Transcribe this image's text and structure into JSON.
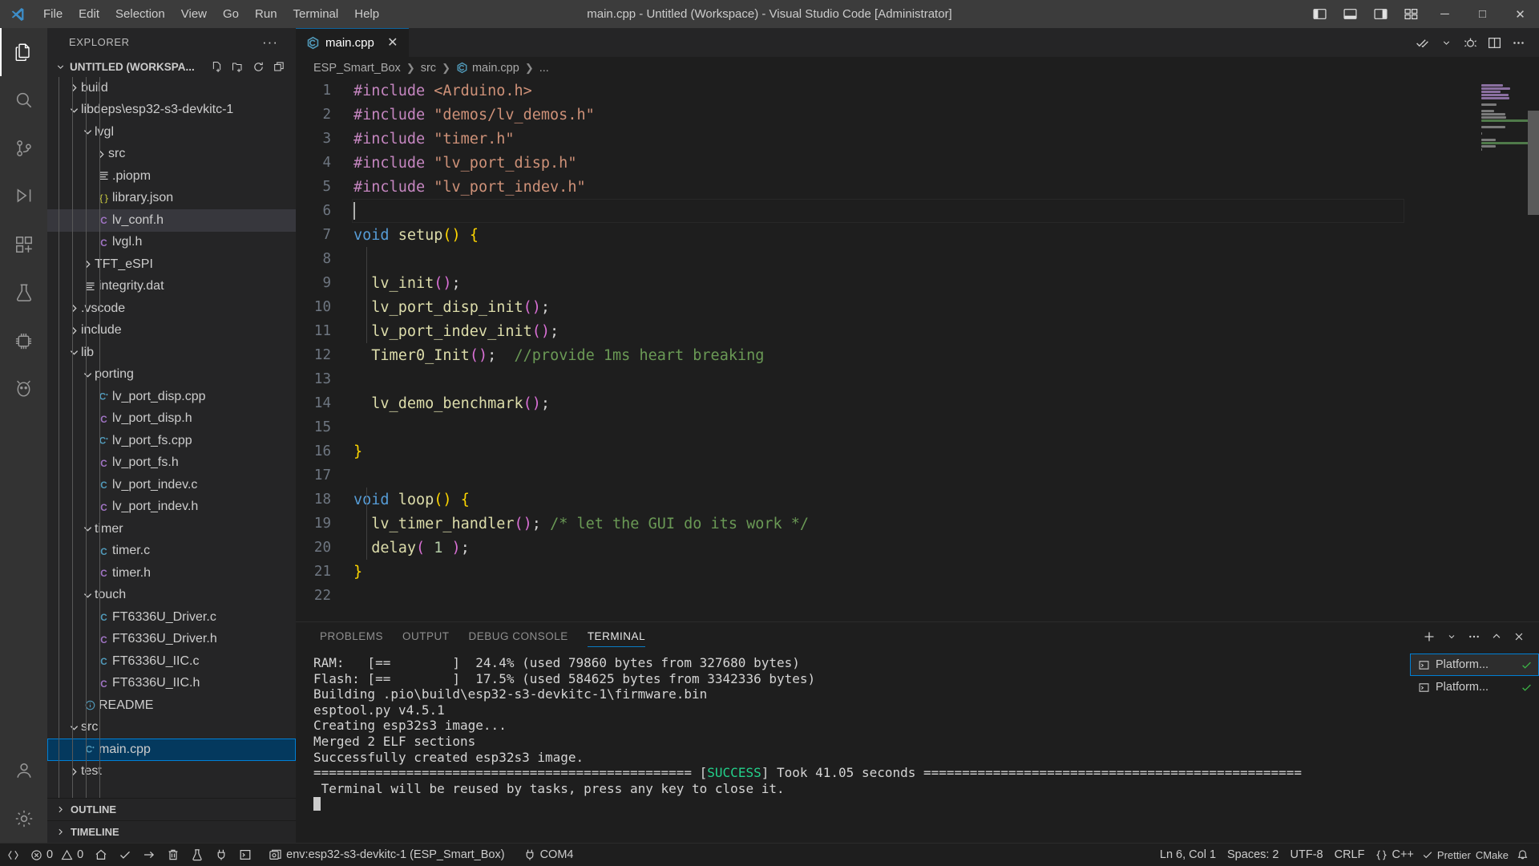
{
  "window": {
    "title": "main.cpp - Untitled (Workspace) - Visual Studio Code [Administrator]",
    "menu": [
      "File",
      "Edit",
      "Selection",
      "View",
      "Go",
      "Run",
      "Terminal",
      "Help"
    ],
    "controls": {
      "minimize": "─",
      "maximize": "□",
      "close": "✕"
    },
    "layout_icons": [
      "panel-left-icon",
      "panel-bottom-icon",
      "panel-right-icon",
      "customize-layout-icon"
    ]
  },
  "activitybar": {
    "items": [
      {
        "name": "explorer",
        "icon": "files-icon",
        "active": true
      },
      {
        "name": "search",
        "icon": "search-icon",
        "active": false
      },
      {
        "name": "source-control",
        "icon": "source-control-icon",
        "active": false
      },
      {
        "name": "run-and-debug",
        "icon": "debug-icon",
        "active": false
      },
      {
        "name": "extensions",
        "icon": "extensions-icon",
        "active": false
      },
      {
        "name": "testing",
        "icon": "beaker-icon",
        "active": false
      },
      {
        "name": "platformio",
        "icon": "platformio-icon",
        "active": false
      },
      {
        "name": "pio-home",
        "icon": "alien-icon",
        "active": false
      }
    ],
    "bottom": [
      {
        "name": "accounts",
        "icon": "account-icon"
      },
      {
        "name": "settings",
        "icon": "gear-icon"
      }
    ]
  },
  "sidebar": {
    "title": "EXPLORER",
    "more_label": "···",
    "workspace": {
      "label": "UNTITLED (WORKSPA...",
      "actions": [
        "new-file-icon",
        "new-folder-icon",
        "refresh-icon",
        "collapse-all-icon"
      ]
    },
    "tree": [
      {
        "label": "build",
        "depth": 2,
        "type": "folder",
        "state": "collapsed",
        "icon": "chevron-right-icon"
      },
      {
        "label": "libdeps\\esp32-s3-devkitc-1",
        "depth": 2,
        "type": "folder",
        "state": "expanded",
        "icon": "chevron-down-icon"
      },
      {
        "label": "lvgl",
        "depth": 3,
        "type": "folder",
        "state": "expanded",
        "icon": "chevron-down-icon"
      },
      {
        "label": "src",
        "depth": 4,
        "type": "folder",
        "state": "collapsed",
        "icon": "chevron-right-icon"
      },
      {
        "label": ".piopm",
        "depth": 4,
        "type": "file",
        "icon": "text-file-icon"
      },
      {
        "label": "library.json",
        "depth": 4,
        "type": "file",
        "icon": "json-icon"
      },
      {
        "label": "lv_conf.h",
        "depth": 4,
        "type": "file",
        "icon": "c-header-icon",
        "selected": "inactive"
      },
      {
        "label": "lvgl.h",
        "depth": 4,
        "type": "file",
        "icon": "c-header-icon"
      },
      {
        "label": "TFT_eSPI",
        "depth": 3,
        "type": "folder",
        "state": "collapsed",
        "icon": "chevron-right-icon"
      },
      {
        "label": "integrity.dat",
        "depth": 3,
        "type": "file",
        "icon": "text-file-icon"
      },
      {
        "label": ".vscode",
        "depth": 2,
        "type": "folder",
        "state": "collapsed",
        "icon": "chevron-right-icon"
      },
      {
        "label": "include",
        "depth": 2,
        "type": "folder",
        "state": "collapsed",
        "icon": "chevron-right-icon"
      },
      {
        "label": "lib",
        "depth": 2,
        "type": "folder",
        "state": "expanded",
        "icon": "chevron-down-icon"
      },
      {
        "label": "porting",
        "depth": 3,
        "type": "folder",
        "state": "expanded",
        "icon": "chevron-down-icon"
      },
      {
        "label": "lv_port_disp.cpp",
        "depth": 4,
        "type": "file",
        "icon": "cpp-icon"
      },
      {
        "label": "lv_port_disp.h",
        "depth": 4,
        "type": "file",
        "icon": "c-header-icon"
      },
      {
        "label": "lv_port_fs.cpp",
        "depth": 4,
        "type": "file",
        "icon": "cpp-icon"
      },
      {
        "label": "lv_port_fs.h",
        "depth": 4,
        "type": "file",
        "icon": "c-header-icon"
      },
      {
        "label": "lv_port_indev.c",
        "depth": 4,
        "type": "file",
        "icon": "c-source-icon"
      },
      {
        "label": "lv_port_indev.h",
        "depth": 4,
        "type": "file",
        "icon": "c-header-icon"
      },
      {
        "label": "timer",
        "depth": 3,
        "type": "folder",
        "state": "expanded",
        "icon": "chevron-down-icon"
      },
      {
        "label": "timer.c",
        "depth": 4,
        "type": "file",
        "icon": "c-source-icon"
      },
      {
        "label": "timer.h",
        "depth": 4,
        "type": "file",
        "icon": "c-header-icon"
      },
      {
        "label": "touch",
        "depth": 3,
        "type": "folder",
        "state": "expanded",
        "icon": "chevron-down-icon"
      },
      {
        "label": "FT6336U_Driver.c",
        "depth": 4,
        "type": "file",
        "icon": "c-source-icon"
      },
      {
        "label": "FT6336U_Driver.h",
        "depth": 4,
        "type": "file",
        "icon": "c-header-icon"
      },
      {
        "label": "FT6336U_IIC.c",
        "depth": 4,
        "type": "file",
        "icon": "c-source-icon"
      },
      {
        "label": "FT6336U_IIC.h",
        "depth": 4,
        "type": "file",
        "icon": "c-header-icon"
      },
      {
        "label": "README",
        "depth": 3,
        "type": "file",
        "icon": "info-icon"
      },
      {
        "label": "src",
        "depth": 2,
        "type": "folder",
        "state": "expanded",
        "icon": "chevron-down-icon"
      },
      {
        "label": "main.cpp",
        "depth": 3,
        "type": "file",
        "icon": "cpp-icon",
        "selected": "focus"
      },
      {
        "label": "test",
        "depth": 2,
        "type": "folder",
        "state": "collapsed",
        "icon": "chevron-right-icon"
      }
    ],
    "panels": [
      {
        "label": "OUTLINE",
        "icon": "chevron-right-icon"
      },
      {
        "label": "TIMELINE",
        "icon": "chevron-right-icon"
      }
    ]
  },
  "editor": {
    "tabs": [
      {
        "label": "main.cpp",
        "icon": "cpp-icon",
        "active": true,
        "close": "✕"
      }
    ],
    "tab_actions": [
      "check-all-icon",
      "chevron-down-icon",
      "debug-alt-icon",
      "split-editor-icon",
      "more-actions-icon"
    ],
    "breadcrumb": [
      "ESP_Smart_Box",
      "src",
      "main.cpp",
      "..."
    ],
    "breadcrumb_icon": "cpp-icon",
    "cursor_line": 6,
    "lines": [
      {
        "n": 1,
        "tokens": [
          {
            "t": "#include ",
            "c": "directive"
          },
          {
            "t": "<Arduino.h>",
            "c": "string"
          }
        ]
      },
      {
        "n": 2,
        "tokens": [
          {
            "t": "#include ",
            "c": "directive"
          },
          {
            "t": "\"demos/lv_demos.h\"",
            "c": "string"
          }
        ]
      },
      {
        "n": 3,
        "tokens": [
          {
            "t": "#include ",
            "c": "directive"
          },
          {
            "t": "\"timer.h\"",
            "c": "string"
          }
        ]
      },
      {
        "n": 4,
        "tokens": [
          {
            "t": "#include ",
            "c": "directive"
          },
          {
            "t": "\"lv_port_disp.h\"",
            "c": "string"
          }
        ]
      },
      {
        "n": 5,
        "tokens": [
          {
            "t": "#include ",
            "c": "directive"
          },
          {
            "t": "\"lv_port_indev.h\"",
            "c": "string"
          }
        ]
      },
      {
        "n": 6,
        "tokens": []
      },
      {
        "n": 7,
        "tokens": [
          {
            "t": "void",
            "c": "keyword"
          },
          {
            "t": " ",
            "c": "plain"
          },
          {
            "t": "setup",
            "c": "func"
          },
          {
            "t": "()",
            "c": "yellow"
          },
          {
            "t": " ",
            "c": "plain"
          },
          {
            "t": "{",
            "c": "yellow"
          }
        ]
      },
      {
        "n": 8,
        "tokens": []
      },
      {
        "n": 9,
        "tokens": [
          {
            "t": "  ",
            "c": "plain"
          },
          {
            "t": "lv_init",
            "c": "func"
          },
          {
            "t": "()",
            "c": "magenta"
          },
          {
            "t": ";",
            "c": "plain"
          }
        ]
      },
      {
        "n": 10,
        "tokens": [
          {
            "t": "  ",
            "c": "plain"
          },
          {
            "t": "lv_port_disp_init",
            "c": "func"
          },
          {
            "t": "()",
            "c": "magenta"
          },
          {
            "t": ";",
            "c": "plain"
          }
        ]
      },
      {
        "n": 11,
        "tokens": [
          {
            "t": "  ",
            "c": "plain"
          },
          {
            "t": "lv_port_indev_init",
            "c": "func"
          },
          {
            "t": "()",
            "c": "magenta"
          },
          {
            "t": ";",
            "c": "plain"
          }
        ]
      },
      {
        "n": 12,
        "tokens": [
          {
            "t": "  ",
            "c": "plain"
          },
          {
            "t": "Timer0_Init",
            "c": "func"
          },
          {
            "t": "()",
            "c": "magenta"
          },
          {
            "t": ";  ",
            "c": "plain"
          },
          {
            "t": "//provide 1ms heart breaking",
            "c": "comment"
          }
        ]
      },
      {
        "n": 13,
        "tokens": []
      },
      {
        "n": 14,
        "tokens": [
          {
            "t": "  ",
            "c": "plain"
          },
          {
            "t": "lv_demo_benchmark",
            "c": "func"
          },
          {
            "t": "()",
            "c": "magenta"
          },
          {
            "t": ";",
            "c": "plain"
          }
        ]
      },
      {
        "n": 15,
        "tokens": []
      },
      {
        "n": 16,
        "tokens": [
          {
            "t": "}",
            "c": "yellow"
          }
        ]
      },
      {
        "n": 17,
        "tokens": []
      },
      {
        "n": 18,
        "tokens": [
          {
            "t": "void",
            "c": "keyword"
          },
          {
            "t": " ",
            "c": "plain"
          },
          {
            "t": "loop",
            "c": "func"
          },
          {
            "t": "()",
            "c": "yellow"
          },
          {
            "t": " ",
            "c": "plain"
          },
          {
            "t": "{",
            "c": "yellow"
          }
        ]
      },
      {
        "n": 19,
        "tokens": [
          {
            "t": "  ",
            "c": "plain"
          },
          {
            "t": "lv_timer_handler",
            "c": "func"
          },
          {
            "t": "()",
            "c": "magenta"
          },
          {
            "t": "; ",
            "c": "plain"
          },
          {
            "t": "/* let the GUI do its work */",
            "c": "comment"
          }
        ]
      },
      {
        "n": 20,
        "tokens": [
          {
            "t": "  ",
            "c": "plain"
          },
          {
            "t": "delay",
            "c": "func"
          },
          {
            "t": "(",
            "c": "magenta"
          },
          {
            "t": " ",
            "c": "plain"
          },
          {
            "t": "1",
            "c": "number"
          },
          {
            "t": " ",
            "c": "plain"
          },
          {
            "t": ")",
            "c": "magenta"
          },
          {
            "t": ";",
            "c": "plain"
          }
        ]
      },
      {
        "n": 21,
        "tokens": [
          {
            "t": "}",
            "c": "yellow"
          }
        ]
      },
      {
        "n": 22,
        "tokens": []
      }
    ]
  },
  "panel": {
    "tabs": [
      {
        "label": "PROBLEMS",
        "active": false
      },
      {
        "label": "OUTPUT",
        "active": false
      },
      {
        "label": "DEBUG CONSOLE",
        "active": false
      },
      {
        "label": "TERMINAL",
        "active": true
      }
    ],
    "actions": [
      "add-terminal-icon",
      "chevron-down-icon",
      "more-actions-icon",
      "maximize-panel-icon",
      "close-panel-icon"
    ],
    "terminal_lines": [
      {
        "segments": [
          {
            "t": "RAM:   [==        ]  24.4% (used 79860 bytes from 327680 bytes)",
            "c": "plain"
          }
        ]
      },
      {
        "segments": [
          {
            "t": "Flash: [==        ]  17.5% (used 584625 bytes from 3342336 bytes)",
            "c": "plain"
          }
        ]
      },
      {
        "segments": [
          {
            "t": "Building .pio\\build\\esp32-s3-devkitc-1\\firmware.bin",
            "c": "plain"
          }
        ]
      },
      {
        "segments": [
          {
            "t": "esptool.py v4.5.1",
            "c": "plain"
          }
        ]
      },
      {
        "segments": [
          {
            "t": "Creating esp32s3 image...",
            "c": "plain"
          }
        ]
      },
      {
        "segments": [
          {
            "t": "Merged 2 ELF sections",
            "c": "plain"
          }
        ]
      },
      {
        "segments": [
          {
            "t": "Successfully created esp32s3 image.",
            "c": "plain"
          }
        ]
      },
      {
        "segments": [
          {
            "t": "================================================= [",
            "c": "plain"
          },
          {
            "t": "SUCCESS",
            "c": "green"
          },
          {
            "t": "] Took 41.05 seconds =================================================",
            "c": "plain"
          }
        ]
      },
      {
        "segments": [
          {
            "t": " Terminal will be reused by tasks, press any key to close it.",
            "c": "plain"
          }
        ]
      }
    ],
    "terminal_list": [
      {
        "label": "Platform...",
        "icon": "terminal-icon",
        "status": "check-icon",
        "active": true
      },
      {
        "label": "Platform...",
        "icon": "terminal-icon",
        "status": "check-icon",
        "active": false
      }
    ]
  },
  "statusbar": {
    "left": [
      {
        "name": "remote-indicator",
        "icon": "remote-icon",
        "label": ""
      },
      {
        "name": "problems",
        "icon": "error-icon",
        "label": "0",
        "icon2": "warning-icon",
        "label2": "0"
      },
      {
        "name": "pio-home",
        "icon": "home-icon",
        "label": ""
      },
      {
        "name": "pio-build",
        "icon": "check-icon",
        "label": ""
      },
      {
        "name": "pio-upload",
        "icon": "arrow-right-icon",
        "label": ""
      },
      {
        "name": "pio-clean",
        "icon": "trash-icon",
        "label": ""
      },
      {
        "name": "pio-test",
        "icon": "beaker-icon",
        "label": ""
      },
      {
        "name": "pio-serial-monitor",
        "icon": "plug-icon",
        "label": ""
      },
      {
        "name": "pio-new-terminal",
        "icon": "terminal-icon",
        "label": ""
      },
      {
        "name": "pio-project-env",
        "icon": "pio-env-icon",
        "label": "env:esp32-s3-devkitc-1 (ESP_Smart_Box)"
      },
      {
        "name": "pio-serial-port",
        "icon": "plug-icon",
        "label": "COM4"
      }
    ],
    "right": [
      {
        "name": "editor-position",
        "label": "Ln 6, Col 1"
      },
      {
        "name": "editor-indentation",
        "label": "Spaces: 2"
      },
      {
        "name": "editor-encoding",
        "label": "UTF-8"
      },
      {
        "name": "editor-eol",
        "label": "CRLF"
      },
      {
        "name": "editor-language",
        "label": "C++",
        "icon": "braces-icon"
      },
      {
        "name": "prettier",
        "label": "Prettier",
        "icon": "check-icon"
      },
      {
        "name": "cmake-tools",
        "label": "CMake",
        "icon": ""
      },
      {
        "name": "notifications",
        "icon": "bell-icon",
        "label": ""
      }
    ]
  },
  "colors": {
    "accent": "#007fd4",
    "titlebar_bg": "#3c3c3c",
    "activitybar_bg": "#333333",
    "sidebar_bg": "#252526",
    "editor_bg": "#1e1e1e",
    "keyword": "#569cd6",
    "string": "#ce9178",
    "directive": "#c586c0",
    "comment": "#6a9955",
    "func": "#dcdcaa",
    "number": "#b5cea8",
    "magenta": "#da70d6",
    "yellow": "#ffd700",
    "success_green": "#23d18b",
    "plain": "#d4d4d4",
    "linenum": "#6e7681"
  }
}
